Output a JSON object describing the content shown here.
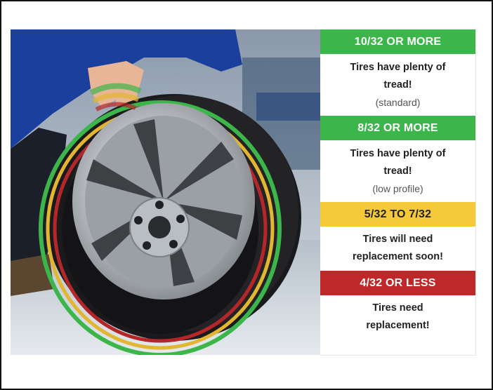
{
  "colors": {
    "green": "#3cb54a",
    "yellow": "#f6c93a",
    "red": "#be2828"
  },
  "image": {
    "subject_icon": "tire-tread-gauge-photo-icon"
  },
  "rows": [
    {
      "heading": "10/32 OR MORE",
      "color": "green",
      "lines": [
        "Tires have plenty of",
        "tread!"
      ],
      "note": "(standard)"
    },
    {
      "heading": "8/32 OR MORE",
      "color": "green",
      "lines": [
        "Tires have plenty of",
        "tread!"
      ],
      "note": "(low profile)"
    },
    {
      "heading": "5/32 TO 7/32",
      "color": "yellow",
      "lines": [
        "Tires will need",
        "replacement soon!"
      ],
      "note": ""
    },
    {
      "heading": "4/32 OR LESS",
      "color": "red",
      "lines": [
        "Tires need",
        "replacement!"
      ],
      "note": ""
    }
  ]
}
